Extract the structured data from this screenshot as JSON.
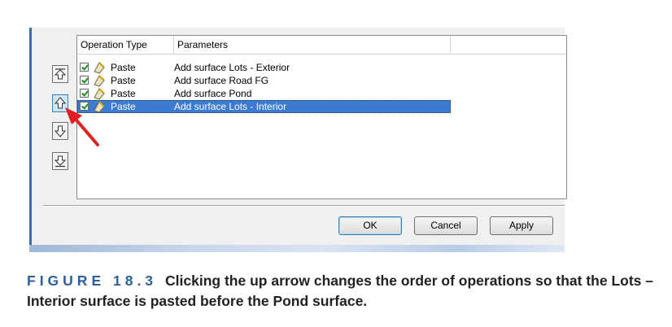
{
  "listview": {
    "columns": [
      "Operation Type",
      "Parameters"
    ],
    "rows": [
      {
        "checked": true,
        "type": "Paste",
        "params": "Add surface Lots - Exterior",
        "selected": false
      },
      {
        "checked": true,
        "type": "Paste",
        "params": "Add surface Road FG",
        "selected": false
      },
      {
        "checked": true,
        "type": "Paste",
        "params": "Add surface Pond",
        "selected": false
      },
      {
        "checked": true,
        "type": "Paste",
        "params": "Add surface Lots - Interior",
        "selected": true
      }
    ]
  },
  "side_buttons": [
    {
      "icon": "move-to-top-icon"
    },
    {
      "icon": "move-up-icon"
    },
    {
      "icon": "move-down-icon"
    },
    {
      "icon": "move-to-bottom-icon"
    }
  ],
  "dialog_buttons": {
    "ok": "OK",
    "cancel": "Cancel",
    "apply": "Apply"
  },
  "caption": {
    "label": "FIGURE 18.3",
    "text": "Clicking the up arrow changes the order of operations so that the Lots – Interior surface is pasted before the Pond surface."
  },
  "colors": {
    "selection": "#3d7bd0",
    "check": "#1f8c1f",
    "annotation_arrow": "#e02020",
    "figure_label": "#2c5f9e"
  }
}
